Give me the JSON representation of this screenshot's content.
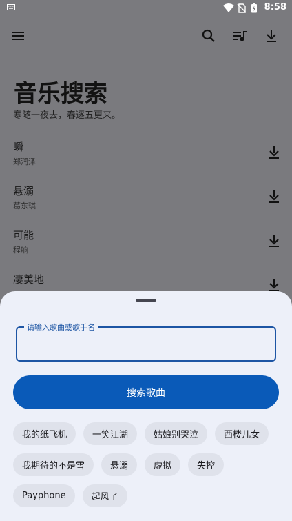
{
  "status_bar": {
    "left_icon": "keyboard-icon",
    "time": "8:58",
    "icons": [
      "wifi-icon",
      "no-sim-icon",
      "battery-icon"
    ]
  },
  "toolbar": {
    "menu_icon": "menu-icon",
    "search_icon": "search-icon",
    "playlist_icon": "playlist-icon",
    "download_icon": "download-icon"
  },
  "header": {
    "title": "音乐搜索",
    "subtitle": "寒随一夜去，春逐五更来。"
  },
  "songs": [
    {
      "title": "瞬",
      "artist": "郑润泽"
    },
    {
      "title": "悬溺",
      "artist": "葛东琪"
    },
    {
      "title": "可能",
      "artist": "程响"
    },
    {
      "title": "凄美地",
      "artist": ""
    }
  ],
  "sheet": {
    "input_label": "请输入歌曲或歌手名",
    "input_value": "",
    "search_button": "搜索歌曲",
    "chips": [
      [
        "我的纸飞机",
        "一笑江湖",
        "姑娘别哭泣",
        "西楼儿女"
      ],
      [
        "我期待的不是雪",
        "悬溺",
        "虚拟",
        "失控"
      ],
      [
        "Payphone",
        "起风了"
      ]
    ]
  },
  "colors": {
    "accent": "#0a5ab8",
    "field_border": "#1d55a4",
    "sheet_bg": "#edf0f9",
    "chip_bg": "#dfe2eb",
    "scrim": "#7a7a7e"
  }
}
